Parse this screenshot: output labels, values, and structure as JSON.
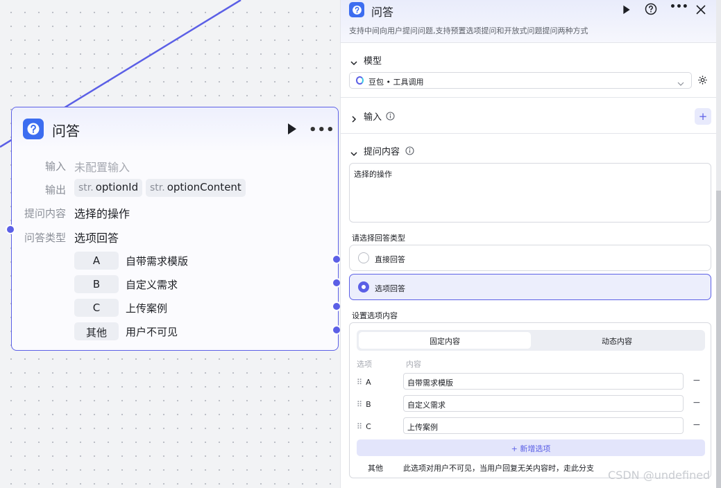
{
  "canvas": {
    "node": {
      "title": "问答",
      "rows": {
        "input_label": "输入",
        "input_value": "未配置输入",
        "output_label": "输出",
        "outputs": [
          {
            "type": "str.",
            "name": "optionId"
          },
          {
            "type": "str.",
            "name": "optionContent"
          }
        ],
        "question_label": "提问内容",
        "question_value": "选择的操作",
        "answer_type_label": "问答类型",
        "answer_type_value": "选项回答"
      },
      "options": [
        {
          "key": "A",
          "text": "自带需求模版"
        },
        {
          "key": "B",
          "text": "自定义需求"
        },
        {
          "key": "C",
          "text": "上传案例"
        },
        {
          "key": "其他",
          "text": "用户不可见"
        }
      ]
    }
  },
  "panel": {
    "title": "问答",
    "description": "支持中间向用户提问问题,支持预置选项提问和开放式问题提问两种方式",
    "model_section": {
      "title": "模型",
      "selected_model": "豆包 • 工具调用"
    },
    "input_section": {
      "title": "输入",
      "add_label": "+"
    },
    "question_section": {
      "title": "提问内容",
      "content": "选择的操作"
    },
    "answer_type": {
      "label": "请选择回答类型",
      "options": [
        {
          "label": "直接回答",
          "selected": false
        },
        {
          "label": "选项回答",
          "selected": true
        }
      ]
    },
    "option_settings": {
      "label": "设置选项内容",
      "tabs": [
        {
          "label": "固定内容",
          "active": true
        },
        {
          "label": "动态内容",
          "active": false
        }
      ],
      "col_option": "选项",
      "col_content": "内容",
      "rows": [
        {
          "key": "A",
          "value": "自带需求模版",
          "remove": "−"
        },
        {
          "key": "B",
          "value": "自定义需求",
          "remove": "−"
        },
        {
          "key": "C",
          "value": "上传案例",
          "remove": "−"
        }
      ],
      "grip": "⠿",
      "add_option": "+ 新增选项",
      "other_key": "其他",
      "other_desc": "此选项对用户不可见，当用户回复无关内容时，走此分支"
    }
  },
  "watermark": "CSDN @undefined",
  "colors": {
    "accent": "#5b5fe6",
    "icon_blue": "#3c6df0",
    "canvas_bg": "#f2f3f5"
  },
  "icons": [
    "qa-icon",
    "play-icon",
    "more-icon",
    "help-icon",
    "close-icon",
    "chevron-down-icon",
    "chevron-right-icon",
    "settings-icon",
    "info-icon",
    "model-logo-icon",
    "drag-handle-icon"
  ]
}
